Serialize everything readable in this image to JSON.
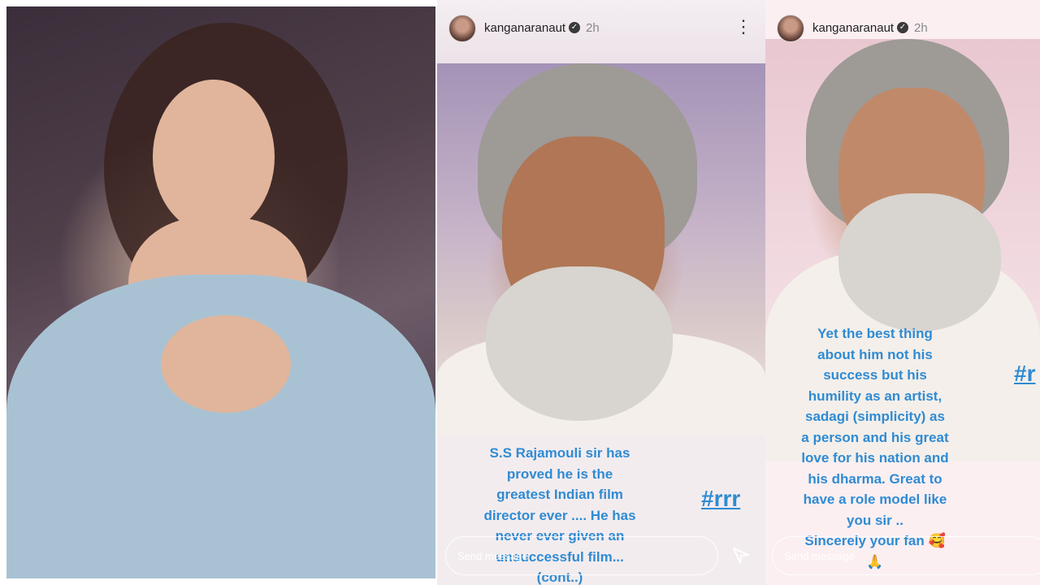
{
  "stories": [
    {
      "username": "kanganaranaut",
      "time": "2h",
      "text": "S.S Rajamouli sir has\nproved he is the\ngreatest Indian film\ndirector ever .... He has\nnever ever given an\nunsuccessful film...\n(cont..)",
      "hashtag": "#rrr",
      "send_placeholder": "Send message"
    },
    {
      "username": "kanganaranaut",
      "time": "2h",
      "text": "Yet the best thing\nabout him not his\nsuccess but his\nhumility as an artist,\nsadagi (simplicity) as\na person and his great\nlove for his nation and\nhis dharma. Great to\nhave a role model like\nyou  sir ..\nSincerely your fan 🥰\n🙏",
      "hashtag": "#r",
      "send_placeholder": "Send message"
    }
  ],
  "icons": {
    "verified": "verified-badge-icon",
    "more": "more-options-icon",
    "send": "send-icon"
  },
  "colors": {
    "text_accent": "#2f8bd3"
  }
}
